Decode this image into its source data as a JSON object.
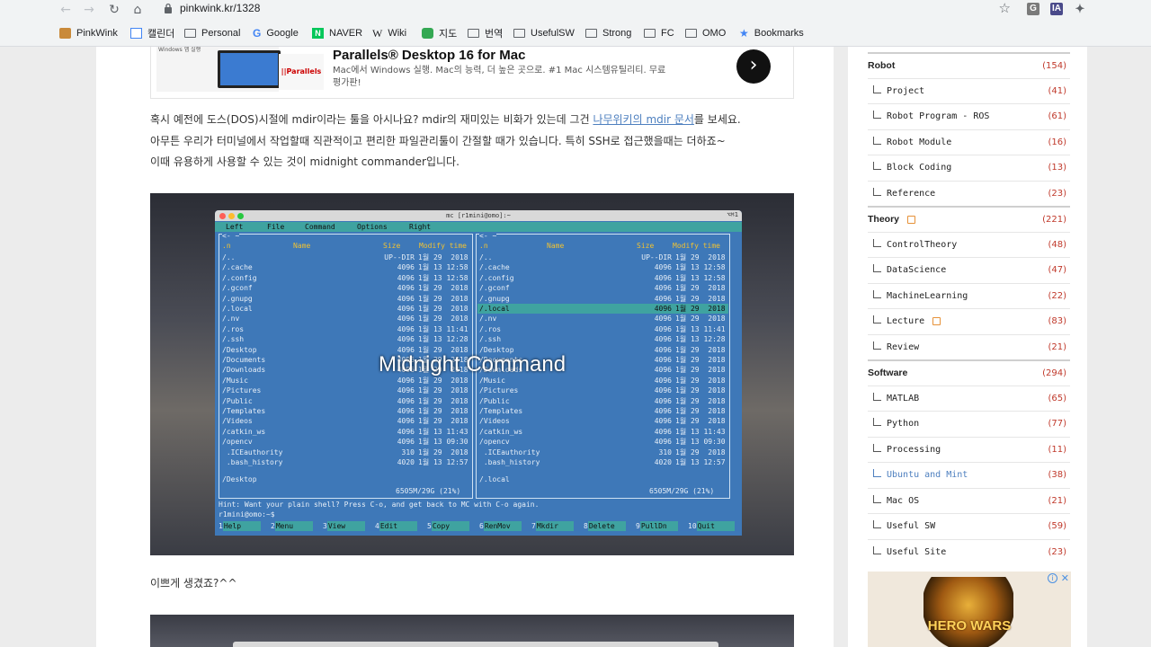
{
  "browser": {
    "url": "pinkwink.kr/1328",
    "back_glyph": "←",
    "forward_glyph": "→",
    "reload_glyph": "↻",
    "home_glyph": "⌂",
    "star_glyph": "☆",
    "ext_g": "G",
    "ext_ia": "IA",
    "ext_puzzle": "✦"
  },
  "bookmarks": [
    {
      "label": "PinkWink",
      "icon": "pinkwink-icon"
    },
    {
      "label": "캘린더",
      "icon": "calendar-icon"
    },
    {
      "label": "Personal",
      "icon": "folder-icon"
    },
    {
      "label": "Google",
      "icon": "google-icon"
    },
    {
      "label": "NAVER",
      "icon": "naver-icon"
    },
    {
      "label": "Wiki",
      "icon": "wiki-icon"
    },
    {
      "label": "지도",
      "icon": "map-icon"
    },
    {
      "label": "번역",
      "icon": "folder-icon"
    },
    {
      "label": "UsefulSW",
      "icon": "folder-icon"
    },
    {
      "label": "Strong",
      "icon": "folder-icon"
    },
    {
      "label": "FC",
      "icon": "folder-icon"
    },
    {
      "label": "OMO",
      "icon": "folder-icon"
    },
    {
      "label": "Bookmarks",
      "icon": "star-icon"
    }
  ],
  "ad": {
    "thumb_text": "Windows 앱 실행",
    "logo_text": "||Parallels",
    "title": "Parallels® Desktop 16 for Mac",
    "desc": "Mac에서 Windows 실행. Mac의 능력, 더 높은 곳으로. #1 Mac 시스템유틸리티. 무료 평가판!",
    "arrow": "›"
  },
  "article": {
    "para1_a": "혹시 예전에 도스(DOS)시절에 mdir이라는 툴을 아시나요? mdir의 재미있는 비화가 있는데 그건 ",
    "para1_link": "나무위키의 mdir 문서",
    "para1_b": "를 보세요.",
    "para2": "아무튼 우리가 터미널에서 작업할때 직관적이고 편리한 파일관리툴이 간절할 때가 있습니다. 특히 SSH로 접근했을때는 더하죠~",
    "para3": "이때 유용하게 사용할 수 있는 것이 midnight commander입니다.",
    "after_image": "이쁘게 생겼죠?^^",
    "video_title": "Midnight Command"
  },
  "terminal": {
    "title": "mc [r1mini@omo]:~",
    "shortcut": "⌥⌘1",
    "menu": [
      "Left",
      "File",
      "Command",
      "Options",
      "Right"
    ],
    "left_path_hdr": "<- ~",
    "right_path_hdr": "<- ~",
    "cols": {
      "n": ".n",
      "name": "Name",
      "size": "Size",
      "mtime": "Modify time"
    },
    "rows": [
      {
        "name": "/..",
        "size": "UP--DIR",
        "time": "1월 29  2018"
      },
      {
        "name": "/.cache",
        "size": "4096",
        "time": "1월 13 12:58"
      },
      {
        "name": "/.config",
        "size": "4096",
        "time": "1월 13 12:58"
      },
      {
        "name": "/.gconf",
        "size": "4096",
        "time": "1월 29  2018"
      },
      {
        "name": "/.gnupg",
        "size": "4096",
        "time": "1월 29  2018"
      },
      {
        "name": "/.local",
        "size": "4096",
        "time": "1월 29  2018"
      },
      {
        "name": "/.nv",
        "size": "4096",
        "time": "1월 29  2018"
      },
      {
        "name": "/.ros",
        "size": "4096",
        "time": "1월 13 11:41"
      },
      {
        "name": "/.ssh",
        "size": "4096",
        "time": "1월 13 12:28"
      },
      {
        "name": "/Desktop",
        "size": "4096",
        "time": "1월 29  2018"
      },
      {
        "name": "/Documents",
        "size": "4096",
        "time": "1월 29  2018"
      },
      {
        "name": "/Downloads",
        "size": "4096",
        "time": "1월 29  2018"
      },
      {
        "name": "/Music",
        "size": "4096",
        "time": "1월 29  2018"
      },
      {
        "name": "/Pictures",
        "size": "4096",
        "time": "1월 29  2018"
      },
      {
        "name": "/Public",
        "size": "4096",
        "time": "1월 29  2018"
      },
      {
        "name": "/Templates",
        "size": "4096",
        "time": "1월 29  2018"
      },
      {
        "name": "/Videos",
        "size": "4096",
        "time": "1월 29  2018"
      },
      {
        "name": "/catkin_ws",
        "size": "4096",
        "time": "1월 13 11:43"
      },
      {
        "name": "/opencv",
        "size": "4096",
        "time": "1월 13 09:30"
      },
      {
        "name": " .ICEauthority",
        "size": "310",
        "time": "1월 29  2018"
      },
      {
        "name": " .bash_history",
        "size": "4020",
        "time": "1월 13 12:57"
      }
    ],
    "left_footer": "/Desktop",
    "right_footer": "/.local",
    "left_free": "6505M/29G (21%)",
    "right_free": "6505M/29G (21%)",
    "hint": "Hint: Want your plain shell? Press C-o, and get back to MC with C-o again.",
    "prompt": "r1mini@omo:~$",
    "fkeys": [
      {
        "n": "1",
        "label": "Help"
      },
      {
        "n": "2",
        "label": "Menu"
      },
      {
        "n": "3",
        "label": "View"
      },
      {
        "n": "4",
        "label": "Edit"
      },
      {
        "n": "5",
        "label": "Copy"
      },
      {
        "n": "6",
        "label": "RenMov"
      },
      {
        "n": "7",
        "label": "Mkdir"
      },
      {
        "n": "8",
        "label": "Delete"
      },
      {
        "n": "9",
        "label": "PullDn"
      },
      {
        "n": "10",
        "label": "Quit"
      }
    ]
  },
  "sidebar": {
    "categories": [
      {
        "label": "Robot",
        "count": "(154)",
        "level": "top"
      },
      {
        "label": "Project",
        "count": "(41)",
        "level": "sub"
      },
      {
        "label": "Robot Program - ROS",
        "count": "(61)",
        "level": "sub"
      },
      {
        "label": "Robot Module",
        "count": "(16)",
        "level": "sub"
      },
      {
        "label": "Block Coding",
        "count": "(13)",
        "level": "sub"
      },
      {
        "label": "Reference",
        "count": "(23)",
        "level": "sub"
      },
      {
        "label": "Theory",
        "count": "(221)",
        "level": "top",
        "new": true
      },
      {
        "label": "ControlTheory",
        "count": "(48)",
        "level": "sub"
      },
      {
        "label": "DataScience",
        "count": "(47)",
        "level": "sub"
      },
      {
        "label": "MachineLearning",
        "count": "(22)",
        "level": "sub"
      },
      {
        "label": "Lecture",
        "count": "(83)",
        "level": "sub",
        "new": true
      },
      {
        "label": "Review",
        "count": "(21)",
        "level": "sub"
      },
      {
        "label": "Software",
        "count": "(294)",
        "level": "top"
      },
      {
        "label": "MATLAB",
        "count": "(65)",
        "level": "sub"
      },
      {
        "label": "Python",
        "count": "(77)",
        "level": "sub"
      },
      {
        "label": "Processing",
        "count": "(11)",
        "level": "sub"
      },
      {
        "label": "Ubuntu and Mint",
        "count": "(38)",
        "level": "sub",
        "active": true
      },
      {
        "label": "Mac OS",
        "count": "(21)",
        "level": "sub"
      },
      {
        "label": "Useful SW",
        "count": "(59)",
        "level": "sub"
      },
      {
        "label": "Useful Site",
        "count": "(23)",
        "level": "sub"
      }
    ],
    "ad": {
      "text": "HERO WARS",
      "info": "i",
      "close": "✕"
    }
  }
}
